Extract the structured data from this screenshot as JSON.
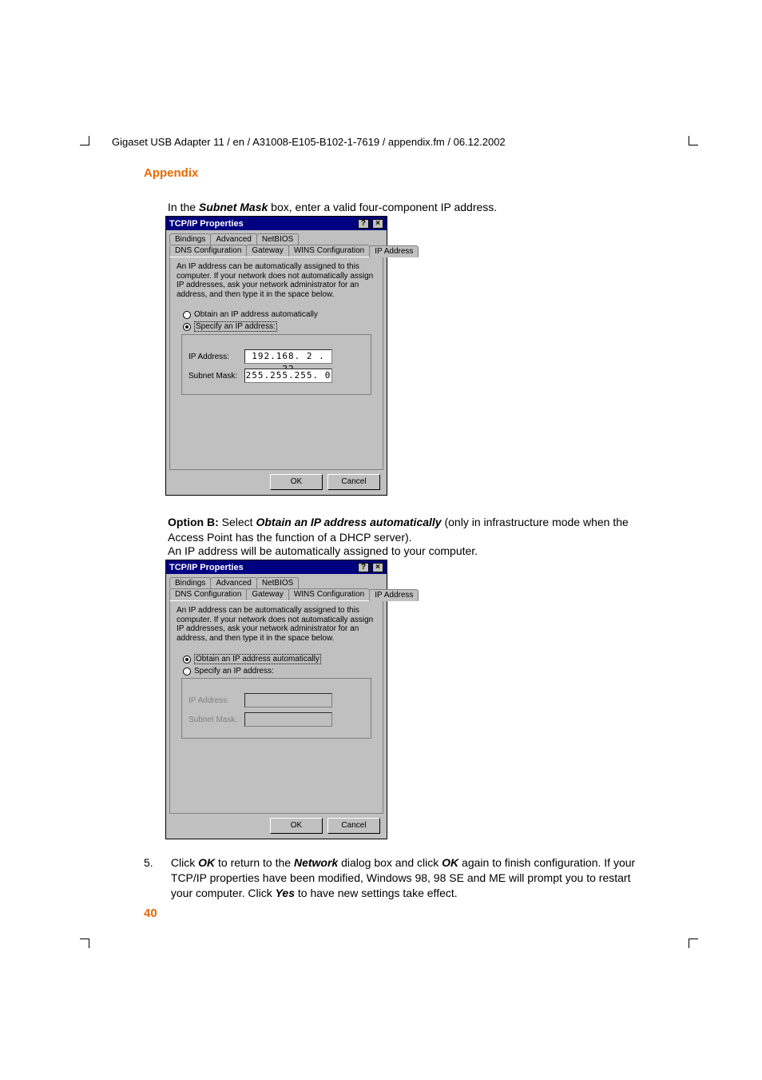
{
  "header_path": "Gigaset USB Adapter 11 / en / A31008-E105-B102-1-7619 / appendix.fm / 06.12.2002",
  "section_title": "Appendix",
  "intro_text_prefix": "In the ",
  "intro_text_bold": "Subnet Mask",
  "intro_text_suffix": " box, enter a valid four-component IP address.",
  "option_b_label": "Option B:",
  "option_b_select": " Select ",
  "option_b_bold": "Obtain an IP address automatically",
  "option_b_suffix": " (only in infrastructure mode when the Access Point has the function of a DHCP server).",
  "auto_assign": "An IP address will be automatically assigned to your computer.",
  "step5_num": "5.",
  "step5_prefix": "Click ",
  "step5_ok1": "OK",
  "step5_mid1": " to return to the ",
  "step5_network": "Network",
  "step5_mid2": " dialog box and click ",
  "step5_ok2": "OK",
  "step5_mid3": " again to finish configuration. If your TCP/IP properties have been modified, Windows 98, 98 SE and ME will prompt you to restart your computer. Click ",
  "step5_yes": "Yes",
  "step5_suffix": " to have new settings take effect.",
  "page_number": "40",
  "dialog": {
    "title": "TCP/IP Properties",
    "help_icon": "?",
    "close_icon": "×",
    "tabs_row1": [
      "Bindings",
      "Advanced",
      "NetBIOS"
    ],
    "tabs_row2": [
      "DNS Configuration",
      "Gateway",
      "WINS Configuration",
      "IP Address"
    ],
    "desc": "An IP address can be automatically assigned to this computer. If your network does not automatically assign IP addresses, ask your network administrator for an address, and then type it in the space below.",
    "radio_auto": "Obtain an IP address automatically",
    "radio_specify": "Specify an IP address:",
    "ip_label": "IP Address:",
    "mask_label": "Subnet Mask:",
    "ip_value": "192.168. 2 . 22",
    "mask_value": "255.255.255. 0",
    "ok": "OK",
    "cancel": "Cancel"
  }
}
